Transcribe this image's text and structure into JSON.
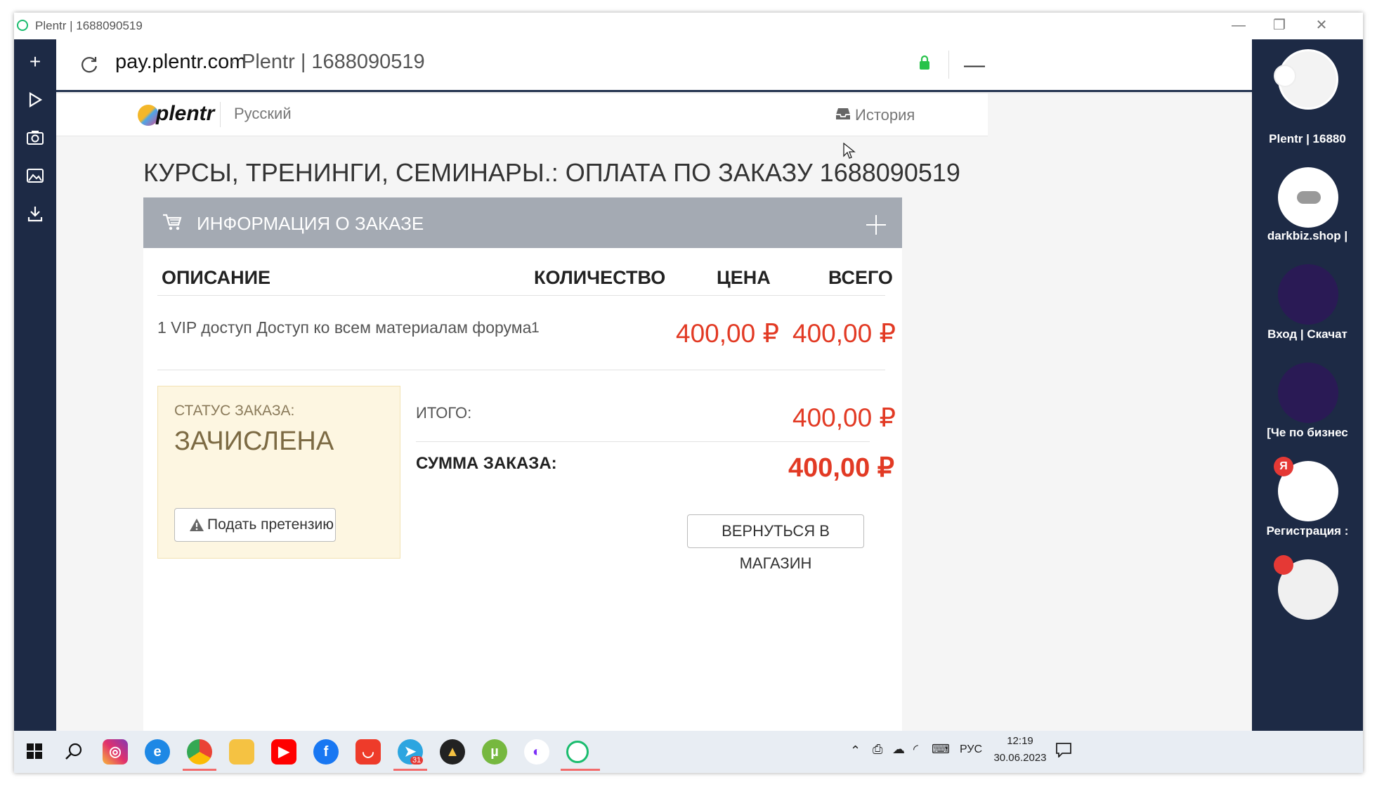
{
  "window": {
    "title": "Plentr | 1688090519"
  },
  "browser": {
    "url_domain": "pay.plentr.com",
    "url_separator": "·",
    "url_title": "Plentr | 1688090519"
  },
  "left_sidebar": {
    "icons": [
      "plus-icon",
      "play-icon",
      "camera-icon",
      "image-icon",
      "download-icon"
    ]
  },
  "site": {
    "logo": "plentr",
    "language": "Русский",
    "history_label": "История"
  },
  "order": {
    "heading": "КУРСЫ, ТРЕНИНГИ, СЕМИНАРЫ.: ОПЛАТА ПО ЗАКАЗУ 1688090519",
    "panel_title": "ИНФОРМАЦИЯ О ЗАКАЗЕ",
    "columns": [
      "ОПИСАНИЕ",
      "КОЛИЧЕСТВО",
      "ЦЕНА",
      "ВСЕГО"
    ],
    "row": {
      "description": "1 VIP доступ Доступ ко всем материалам форума",
      "quantity": "1",
      "price": "400,00 ₽",
      "total": "400,00 ₽"
    },
    "status_label": "СТАТУС ЗАКАЗА:",
    "status_value": "ЗАЧИСЛЕНА",
    "complaint_button": "Подать претензию",
    "subtotal_label": "ИТОГО:",
    "subtotal_value": "400,00 ₽",
    "sum_label": "СУММА ЗАКАЗА:",
    "sum_value": "400,00 ₽",
    "return_button": "ВЕРНУТЬСЯ В МАГАЗИН"
  },
  "speed_dial": [
    {
      "label": "Plentr | 16880"
    },
    {
      "label": "darkbiz.shop |"
    },
    {
      "label": "Вход | Скачат"
    },
    {
      "label": "[Че по бизнес"
    },
    {
      "label": "Регистрация :"
    },
    {
      "label": ""
    }
  ],
  "taskbar": {
    "apps": [
      "instagram",
      "edge",
      "chrome",
      "explorer",
      "youtube",
      "facebook",
      "aliexpress",
      "telegram",
      "aimp",
      "utorrent",
      "app",
      "opera"
    ],
    "telegram_badge": "31",
    "language": "РУС",
    "time": "12:19",
    "date": "30.06.2023"
  },
  "colors": {
    "accent_price": "#e23a24",
    "panel": "#a4aab3",
    "sidebar": "#1d2a45",
    "status_bg": "#fdf6e1"
  }
}
